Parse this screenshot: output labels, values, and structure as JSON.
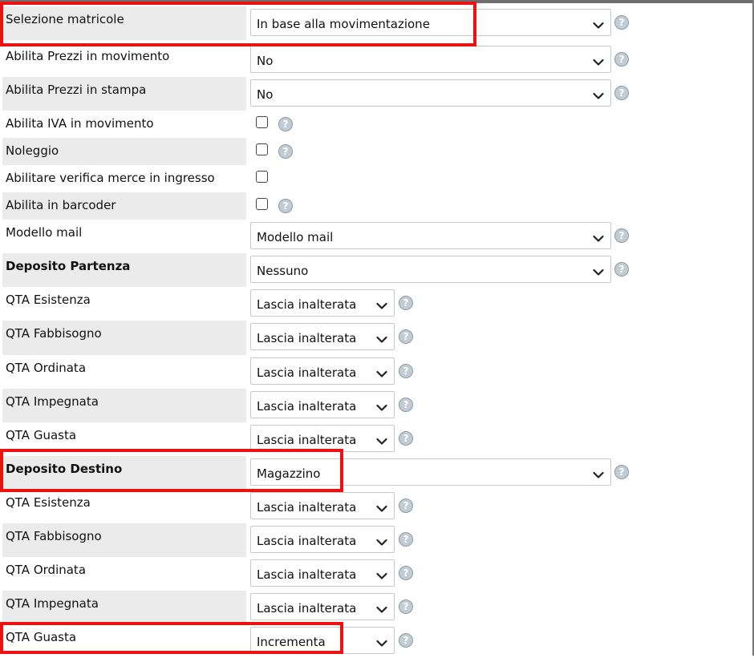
{
  "rows": [
    {
      "label": "Selezione matricole",
      "bold": false,
      "type": "select",
      "size": "wide",
      "value": "In base alla movimentazione",
      "help": true
    },
    {
      "label": "Abilita Prezzi in movimento",
      "bold": false,
      "type": "select",
      "size": "wide",
      "value": "No",
      "help": true
    },
    {
      "label": "Abilita Prezzi in stampa",
      "bold": false,
      "type": "select",
      "size": "wide",
      "value": "No",
      "help": true
    },
    {
      "label": "Abilita IVA in movimento",
      "bold": false,
      "type": "checkbox",
      "checked": false,
      "help": true
    },
    {
      "label": "Noleggio",
      "bold": false,
      "type": "checkbox",
      "checked": false,
      "help": true
    },
    {
      "label": "Abilitare verifica merce in ingresso",
      "bold": false,
      "type": "checkbox",
      "checked": false,
      "help": false
    },
    {
      "label": "Abilita in barcoder",
      "bold": false,
      "type": "checkbox",
      "checked": false,
      "help": true
    },
    {
      "label": "Modello mail",
      "bold": false,
      "type": "select",
      "size": "wide",
      "value": "Modello mail",
      "help": true
    },
    {
      "label": "Deposito Partenza",
      "bold": true,
      "type": "select",
      "size": "wide",
      "value": "Nessuno",
      "help": true
    },
    {
      "label": "QTA Esistenza",
      "bold": false,
      "type": "select",
      "size": "narrow",
      "value": "Lascia inalterata",
      "help": true
    },
    {
      "label": "QTA Fabbisogno",
      "bold": false,
      "type": "select",
      "size": "narrow",
      "value": "Lascia inalterata",
      "help": true
    },
    {
      "label": "QTA Ordinata",
      "bold": false,
      "type": "select",
      "size": "narrow",
      "value": "Lascia inalterata",
      "help": true
    },
    {
      "label": "QTA Impegnata",
      "bold": false,
      "type": "select",
      "size": "narrow",
      "value": "Lascia inalterata",
      "help": true
    },
    {
      "label": "QTA Guasta",
      "bold": false,
      "type": "select",
      "size": "narrow",
      "value": "Lascia inalterata",
      "help": true
    },
    {
      "label": "Deposito Destino",
      "bold": true,
      "type": "select",
      "size": "wide",
      "value": "Magazzino",
      "help": true
    },
    {
      "label": "QTA Esistenza",
      "bold": false,
      "type": "select",
      "size": "narrow",
      "value": "Lascia inalterata",
      "help": true
    },
    {
      "label": "QTA Fabbisogno",
      "bold": false,
      "type": "select",
      "size": "narrow",
      "value": "Lascia inalterata",
      "help": true
    },
    {
      "label": "QTA Ordinata",
      "bold": false,
      "type": "select",
      "size": "narrow",
      "value": "Lascia inalterata",
      "help": true
    },
    {
      "label": "QTA Impegnata",
      "bold": false,
      "type": "select",
      "size": "narrow",
      "value": "Lascia inalterata",
      "help": true
    },
    {
      "label": "QTA Guasta",
      "bold": false,
      "type": "select",
      "size": "narrow",
      "value": "Incrementa",
      "help": true
    }
  ],
  "help_glyph": "?",
  "icons": {
    "dropdown": "chevron-down-icon",
    "help": "help-icon"
  },
  "colors": {
    "highlight": "#ee1111",
    "label_bg": "#ebebeb",
    "help_bg": "#c2ccd4"
  }
}
